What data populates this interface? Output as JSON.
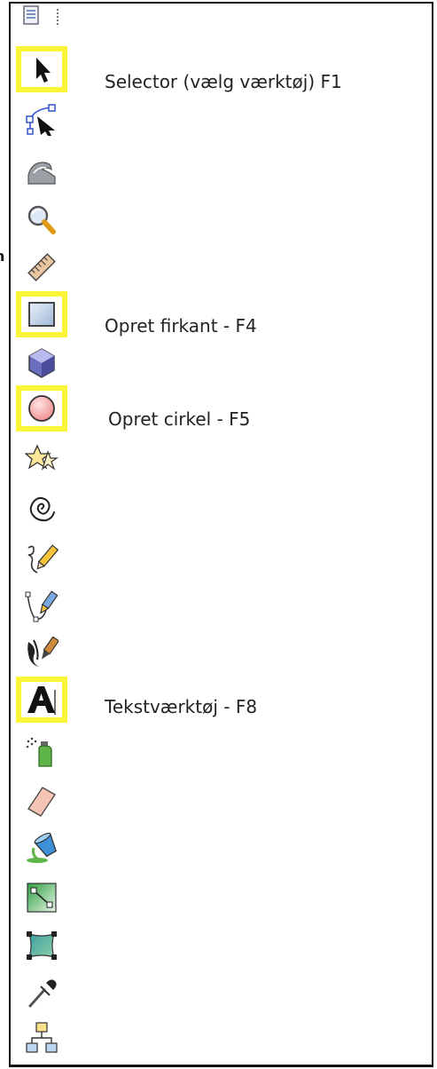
{
  "cut_label_char": "h",
  "labels": {
    "selector": "Selector (vælg værktøj) F1",
    "rectangle": "Opret firkant - F4",
    "circle": "Opret cirkel - F5",
    "text": "Tekstværktøj - F8"
  },
  "colors": {
    "highlight": "#fbf53a",
    "frame": "#111111",
    "text": "#222222"
  },
  "tools": [
    {
      "name": "selector-tool",
      "icon": "arrow-pointer-icon",
      "highlighted": true
    },
    {
      "name": "node-tool",
      "icon": "node-edit-icon",
      "highlighted": false
    },
    {
      "name": "tweak-tool",
      "icon": "wave-icon",
      "highlighted": false
    },
    {
      "name": "zoom-tool",
      "icon": "magnifier-icon",
      "highlighted": false
    },
    {
      "name": "measure-tool",
      "icon": "ruler-icon",
      "highlighted": false
    },
    {
      "name": "rectangle-tool",
      "icon": "rectangle-icon",
      "highlighted": true
    },
    {
      "name": "3d-box-tool",
      "icon": "cube-icon",
      "highlighted": false
    },
    {
      "name": "circle-tool",
      "icon": "circle-icon",
      "highlighted": true
    },
    {
      "name": "star-tool",
      "icon": "star-icon",
      "highlighted": false
    },
    {
      "name": "spiral-tool",
      "icon": "spiral-icon",
      "highlighted": false
    },
    {
      "name": "pencil-tool",
      "icon": "pencil-icon",
      "highlighted": false
    },
    {
      "name": "pen-tool",
      "icon": "pen-bezier-icon",
      "highlighted": false
    },
    {
      "name": "calligraphy-tool",
      "icon": "calligraphy-icon",
      "highlighted": false
    },
    {
      "name": "text-tool",
      "icon": "text-a-icon",
      "highlighted": true
    },
    {
      "name": "spray-tool",
      "icon": "spray-icon",
      "highlighted": false
    },
    {
      "name": "eraser-tool",
      "icon": "eraser-icon",
      "highlighted": false
    },
    {
      "name": "paint-bucket-tool",
      "icon": "paint-bucket-icon",
      "highlighted": false
    },
    {
      "name": "gradient-tool",
      "icon": "gradient-icon",
      "highlighted": false
    },
    {
      "name": "mesh-tool",
      "icon": "mesh-icon",
      "highlighted": false
    },
    {
      "name": "dropper-tool",
      "icon": "dropper-icon",
      "highlighted": false
    },
    {
      "name": "connector-tool",
      "icon": "connector-icon",
      "highlighted": false
    }
  ]
}
